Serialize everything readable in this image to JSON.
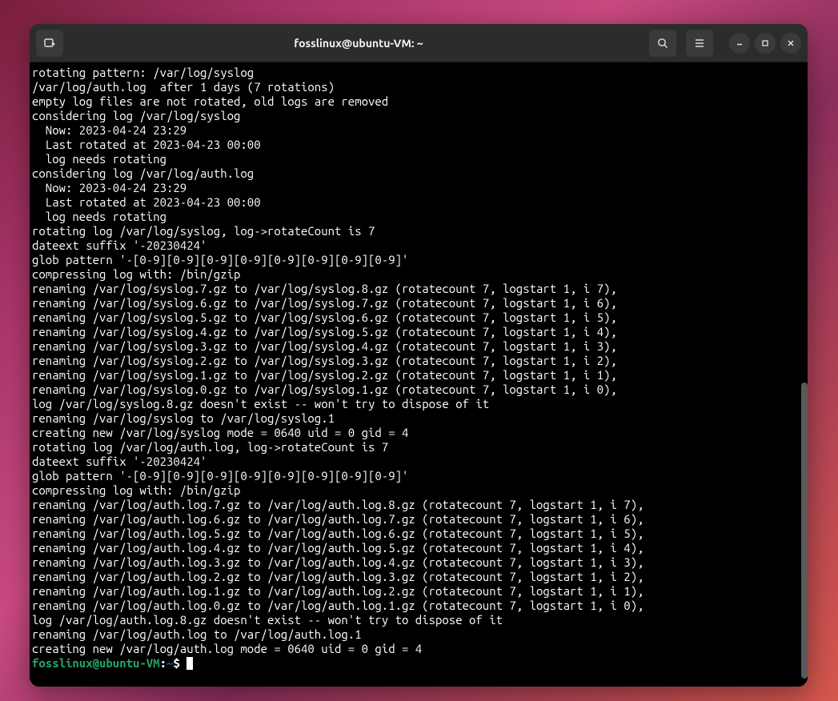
{
  "window": {
    "title": "fosslinux@ubuntu-VM: ~"
  },
  "prompt": {
    "user_host": "fosslinux@ubuntu-VM",
    "separator": ":",
    "path": "~",
    "symbol": "$"
  },
  "terminal_lines": [
    "rotating pattern: /var/log/syslog",
    "/var/log/auth.log  after 1 days (7 rotations)",
    "empty log files are not rotated, old logs are removed",
    "considering log /var/log/syslog",
    "  Now: 2023-04-24 23:29",
    "  Last rotated at 2023-04-23 00:00",
    "  log needs rotating",
    "considering log /var/log/auth.log",
    "  Now: 2023-04-24 23:29",
    "  Last rotated at 2023-04-23 00:00",
    "  log needs rotating",
    "rotating log /var/log/syslog, log->rotateCount is 7",
    "dateext suffix '-20230424'",
    "glob pattern '-[0-9][0-9][0-9][0-9][0-9][0-9][0-9][0-9]'",
    "compressing log with: /bin/gzip",
    "renaming /var/log/syslog.7.gz to /var/log/syslog.8.gz (rotatecount 7, logstart 1, i 7),",
    "renaming /var/log/syslog.6.gz to /var/log/syslog.7.gz (rotatecount 7, logstart 1, i 6),",
    "renaming /var/log/syslog.5.gz to /var/log/syslog.6.gz (rotatecount 7, logstart 1, i 5),",
    "renaming /var/log/syslog.4.gz to /var/log/syslog.5.gz (rotatecount 7, logstart 1, i 4),",
    "renaming /var/log/syslog.3.gz to /var/log/syslog.4.gz (rotatecount 7, logstart 1, i 3),",
    "renaming /var/log/syslog.2.gz to /var/log/syslog.3.gz (rotatecount 7, logstart 1, i 2),",
    "renaming /var/log/syslog.1.gz to /var/log/syslog.2.gz (rotatecount 7, logstart 1, i 1),",
    "renaming /var/log/syslog.0.gz to /var/log/syslog.1.gz (rotatecount 7, logstart 1, i 0),",
    "log /var/log/syslog.8.gz doesn't exist -- won't try to dispose of it",
    "renaming /var/log/syslog to /var/log/syslog.1",
    "creating new /var/log/syslog mode = 0640 uid = 0 gid = 4",
    "rotating log /var/log/auth.log, log->rotateCount is 7",
    "dateext suffix '-20230424'",
    "glob pattern '-[0-9][0-9][0-9][0-9][0-9][0-9][0-9][0-9]'",
    "compressing log with: /bin/gzip",
    "renaming /var/log/auth.log.7.gz to /var/log/auth.log.8.gz (rotatecount 7, logstart 1, i 7),",
    "renaming /var/log/auth.log.6.gz to /var/log/auth.log.7.gz (rotatecount 7, logstart 1, i 6),",
    "renaming /var/log/auth.log.5.gz to /var/log/auth.log.6.gz (rotatecount 7, logstart 1, i 5),",
    "renaming /var/log/auth.log.4.gz to /var/log/auth.log.5.gz (rotatecount 7, logstart 1, i 4),",
    "renaming /var/log/auth.log.3.gz to /var/log/auth.log.4.gz (rotatecount 7, logstart 1, i 3),",
    "renaming /var/log/auth.log.2.gz to /var/log/auth.log.3.gz (rotatecount 7, logstart 1, i 2),",
    "renaming /var/log/auth.log.1.gz to /var/log/auth.log.2.gz (rotatecount 7, logstart 1, i 1),",
    "renaming /var/log/auth.log.0.gz to /var/log/auth.log.1.gz (rotatecount 7, logstart 1, i 0),",
    "log /var/log/auth.log.8.gz doesn't exist -- won't try to dispose of it",
    "renaming /var/log/auth.log to /var/log/auth.log.1",
    "creating new /var/log/auth.log mode = 0640 uid = 0 gid = 4"
  ]
}
